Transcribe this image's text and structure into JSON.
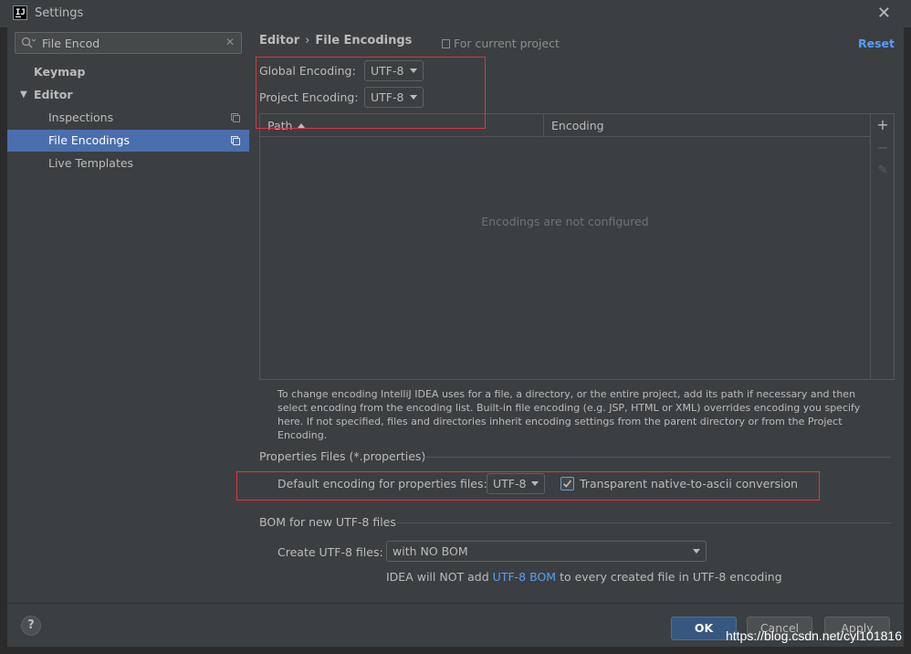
{
  "window": {
    "title": "Settings",
    "app_icon": "IJ"
  },
  "search": {
    "value": "File Encod"
  },
  "sidebar": {
    "items": [
      {
        "label": "Keymap"
      },
      {
        "label": "Editor"
      },
      {
        "label": "Inspections"
      },
      {
        "label": "File Encodings"
      },
      {
        "label": "Live Templates"
      }
    ]
  },
  "header": {
    "crumb_parent": "Editor",
    "crumb_sep": "›",
    "crumb_current": "File Encodings",
    "scope": "For current project",
    "reset": "Reset"
  },
  "encoding": {
    "global_label": "Global Encoding:",
    "global_value": "UTF-8",
    "project_label": "Project Encoding:",
    "project_value": "UTF-8"
  },
  "table": {
    "columns": [
      "Path",
      "Encoding"
    ],
    "empty_text": "Encodings are not configured"
  },
  "hint": "To change encoding IntelliJ IDEA uses for a file, a directory, or the entire project, add its path if necessary and then select encoding from the encoding list. Built-in file encoding (e.g. JSP, HTML or XML) overrides encoding you specify here. If not specified, files and directories inherit encoding settings from the parent directory or from the Project Encoding.",
  "properties": {
    "section_title": "Properties Files (*.properties)",
    "default_label": "Default encoding for properties files:",
    "default_value": "UTF-8",
    "transparent_label": "Transparent native-to-ascii conversion",
    "transparent_checked": true
  },
  "bom": {
    "section_title": "BOM for new UTF-8 files",
    "create_label": "Create UTF-8 files:",
    "create_value": "with NO BOM",
    "note_prefix": "IDEA will NOT add",
    "note_link": "UTF-8 BOM",
    "note_suffix": "to every created file in UTF-8 encoding"
  },
  "buttons": {
    "help": "?",
    "ok": "OK",
    "cancel": "Cancel",
    "apply": "Apply"
  },
  "watermark": "https://blog.csdn.net/cyl101816",
  "colors": {
    "selection": "#4b6eaf",
    "link": "#589df6",
    "highlight_box": "#e0353b",
    "primary_button": "#365880"
  }
}
